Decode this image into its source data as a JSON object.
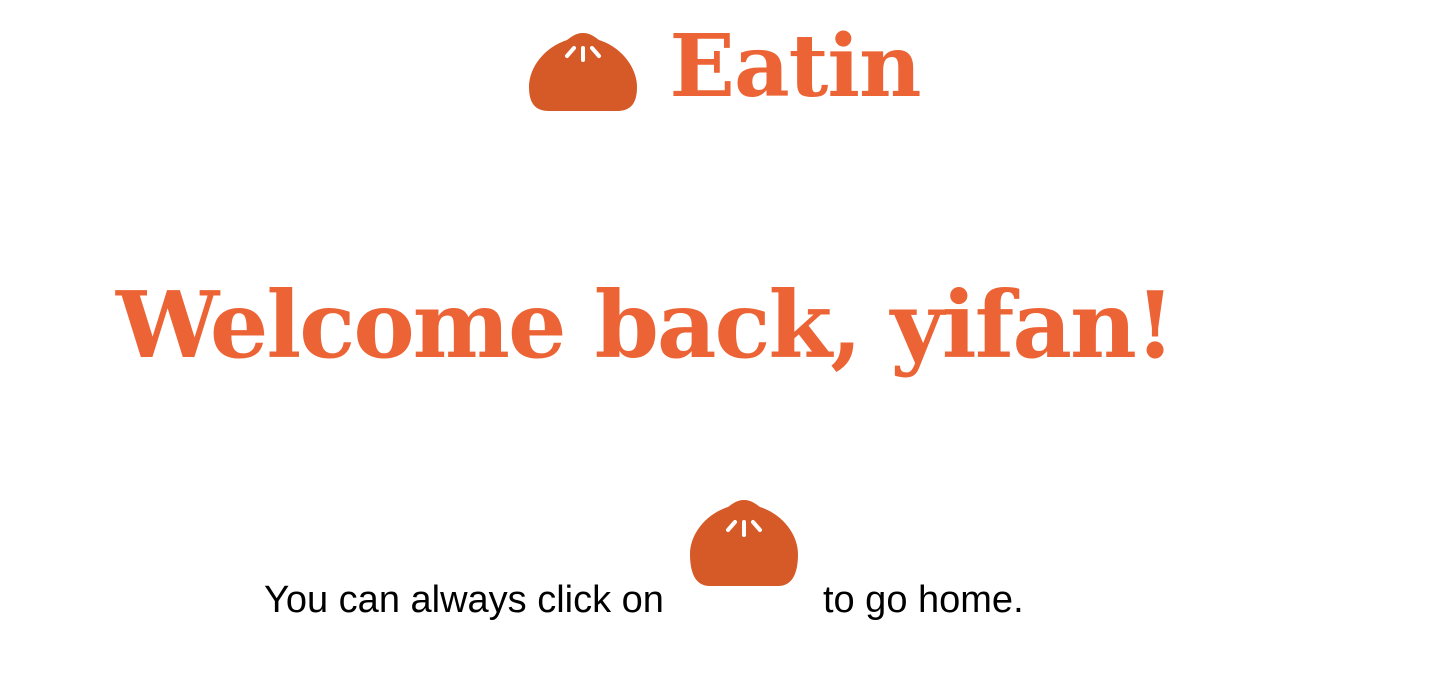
{
  "header": {
    "logo_icon": "bun-icon",
    "brand_name": "Eatin"
  },
  "main": {
    "welcome_title": "Welcome back, yifan!",
    "hint": {
      "before": "You can always click on",
      "icon": "bun-icon",
      "after": "to go home."
    }
  },
  "colors": {
    "brand": "#ec6436",
    "icon": "#d55a27",
    "text": "#000000",
    "background": "#ffffff"
  }
}
